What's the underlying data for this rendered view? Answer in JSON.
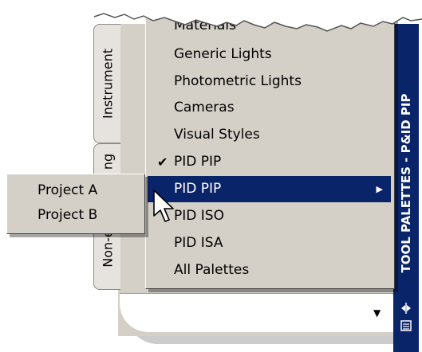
{
  "title_bar": {
    "title": "TOOL PALETTES - P&ID PIP"
  },
  "tabs": [
    {
      "label": "Instrument"
    },
    {
      "label": "Non-e"
    },
    {
      "label": "ng"
    }
  ],
  "menu": {
    "items": [
      {
        "label": "Materials"
      },
      {
        "label": "Generic Lights"
      },
      {
        "label": "Photometric Lights"
      },
      {
        "label": "Cameras"
      },
      {
        "label": "Visual Styles"
      },
      {
        "label": "PID PIP",
        "checked": true
      },
      {
        "label": "PID PIP",
        "highlighted": true,
        "has_submenu": true
      },
      {
        "label": "PID ISO"
      },
      {
        "label": "PID ISA"
      },
      {
        "label": "All Palettes"
      }
    ]
  },
  "submenu": {
    "items": [
      {
        "label": "Project A"
      },
      {
        "label": "Project B"
      }
    ]
  },
  "icons": {
    "check": "✔",
    "submenu_arrow": "▶",
    "scroll_down": "▼"
  },
  "colors": {
    "title_bar": "#0a246a",
    "highlight": "#0a246a",
    "menu_bg": "#d4d0c8"
  }
}
